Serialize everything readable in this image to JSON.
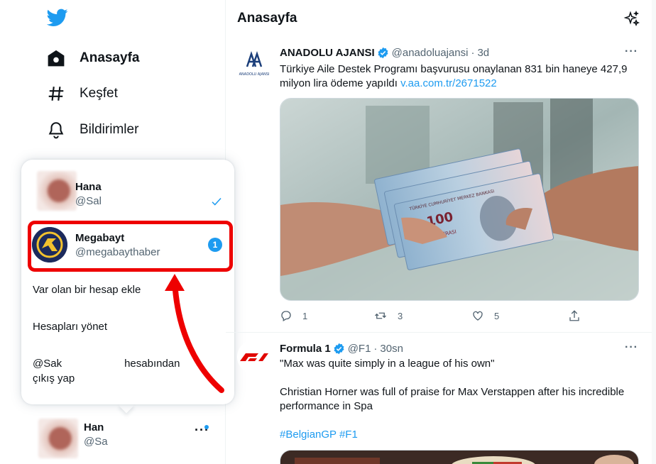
{
  "sidebar": {
    "nav": [
      {
        "label": "Anasayfa",
        "icon": "home-icon",
        "active": true
      },
      {
        "label": "Keşfet",
        "icon": "hashtag-icon",
        "active": false
      },
      {
        "label": "Bildirimler",
        "icon": "bell-icon",
        "active": false
      }
    ]
  },
  "popup": {
    "current_account": {
      "name": "Hana",
      "handle": "@Sal"
    },
    "other_account": {
      "name": "Megabayt",
      "handle": "@megabaythaber",
      "badge": "1"
    },
    "add_account": "Var olan bir hesap ekle",
    "manage_accounts": "Hesapları yönet",
    "logout_handle": "@Sak",
    "logout_suffix": "hesabından",
    "logout_line2": "çıkış yap"
  },
  "bottom_account": {
    "name": "Han",
    "handle": "@Sa",
    "more": "···"
  },
  "main": {
    "title": "Anasayfa",
    "tweets": [
      {
        "name": "ANADOLU AJANSI",
        "handle": "@anadoluajansi",
        "time": "3d",
        "text": "Türkiye Aile Destek Programı başvurusu onaylanan 831 bin haneye 427,9 milyon lira ödeme yapıldı",
        "link": "v.aa.com.tr/2671522",
        "avatar_text": "ANADOLU AJANSI",
        "banknote_denomination": "100",
        "banknote_text": "TÜRK LİRASI",
        "banknote_bank": "TÜRKİYE CUMHURİYET MERKEZ BANKASI",
        "replies": "1",
        "retweets": "3",
        "likes": "5"
      },
      {
        "name": "Formula 1",
        "handle": "@F1",
        "time": "30sn",
        "quote": "\"Max was quite simply in a league of his own\"",
        "body": "Christian Horner was full of praise for Max Verstappen after his incredible performance in Spa",
        "hashtags": "#BelgianGP #F1"
      }
    ]
  },
  "colors": {
    "accent": "#1d9bf0",
    "highlight": "#ee0000",
    "text": "#0f1419",
    "secondary": "#536471"
  }
}
